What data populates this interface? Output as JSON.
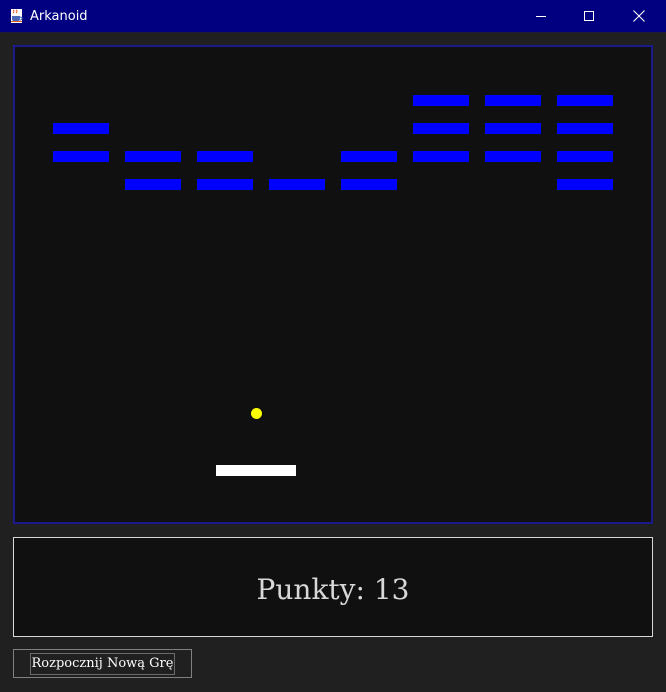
{
  "window": {
    "title": "Arkanoid",
    "icon": "java-cup-icon",
    "controls": [
      "minimize-icon",
      "maximize-icon",
      "close-icon"
    ]
  },
  "colors": {
    "titlebar": "#000080",
    "background": "#202020",
    "game_background": "#101010",
    "game_border": "#1a1a8c",
    "brick": "#0000ff",
    "ball": "#ffff00",
    "paddle": "#ffffff",
    "score_text": "#d8d8d8"
  },
  "game": {
    "brick_grid": {
      "columns": 8,
      "rows": 4,
      "visible": [
        [
          false,
          false,
          false,
          false,
          false,
          true,
          true,
          true
        ],
        [
          true,
          false,
          false,
          false,
          false,
          true,
          true,
          true
        ],
        [
          true,
          true,
          true,
          false,
          true,
          true,
          true,
          true
        ],
        [
          false,
          true,
          true,
          true,
          true,
          false,
          false,
          true
        ]
      ]
    }
  },
  "score": {
    "text": "Punkty: 13"
  },
  "controls": {
    "new_game_label": "Rozpocznij Nową Grę"
  }
}
